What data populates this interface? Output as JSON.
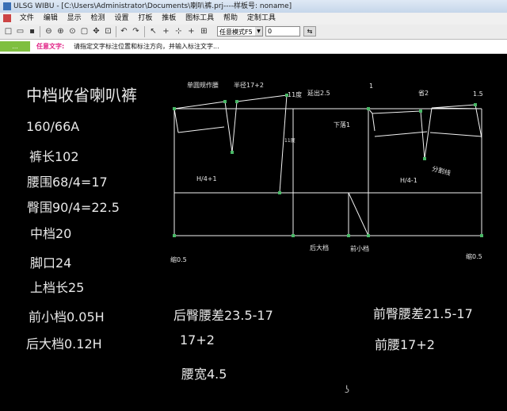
{
  "window": {
    "title": "ULSG WIBU - [C:\\Users\\Administrator\\Documents\\喇叭裤.prj----样板号: noname]"
  },
  "menu": [
    "文件",
    "编辑",
    "显示",
    "检测",
    "设置",
    "打板",
    "推板",
    "图标工具",
    "帮助",
    "定制工具"
  ],
  "toolbar": {
    "mode_value": "任意模式F5",
    "number_value": "0"
  },
  "status": {
    "mode": "...",
    "task": "任意文字:",
    "message": "请指定文字标注位置和标注方向，并输入标注文字..."
  },
  "notes": {
    "title": "中档收省喇叭裤",
    "size": "160/66A",
    "pants_length": "裤长102",
    "waist": "腰围68/4=17",
    "hip": "臀围90/4=22.5",
    "mid_rise": "中档20",
    "hem": "脚口24",
    "upper_rise": "上档长25",
    "front_crotch": "前小档0.05H",
    "back_crotch": "后大档0.12H",
    "back_hip_waist_diff": "后臀腰差23.5-17",
    "back_value": "17+2",
    "waistband": "腰宽4.5",
    "front_hip_waist_diff": "前臀腰差21.5-17",
    "front_waist": "前腰17+2"
  },
  "pattern_labels": {
    "square_waist": "单圆规作腰",
    "radius": "半径17+2",
    "eleven_a": "11度",
    "extend": "延出2.5",
    "eleven_b": "11度",
    "one": "1",
    "darts": "省2",
    "one_five": "1.5",
    "drop": "下落1",
    "h_plus": "H/4+1",
    "h_minus": "H/4-1",
    "split": "分割线",
    "back_crotch": "后大档",
    "front_crotch": "前小档",
    "hem_left": "缩0.5",
    "hem_right": "缩0.5"
  },
  "watermark": "ʖ"
}
